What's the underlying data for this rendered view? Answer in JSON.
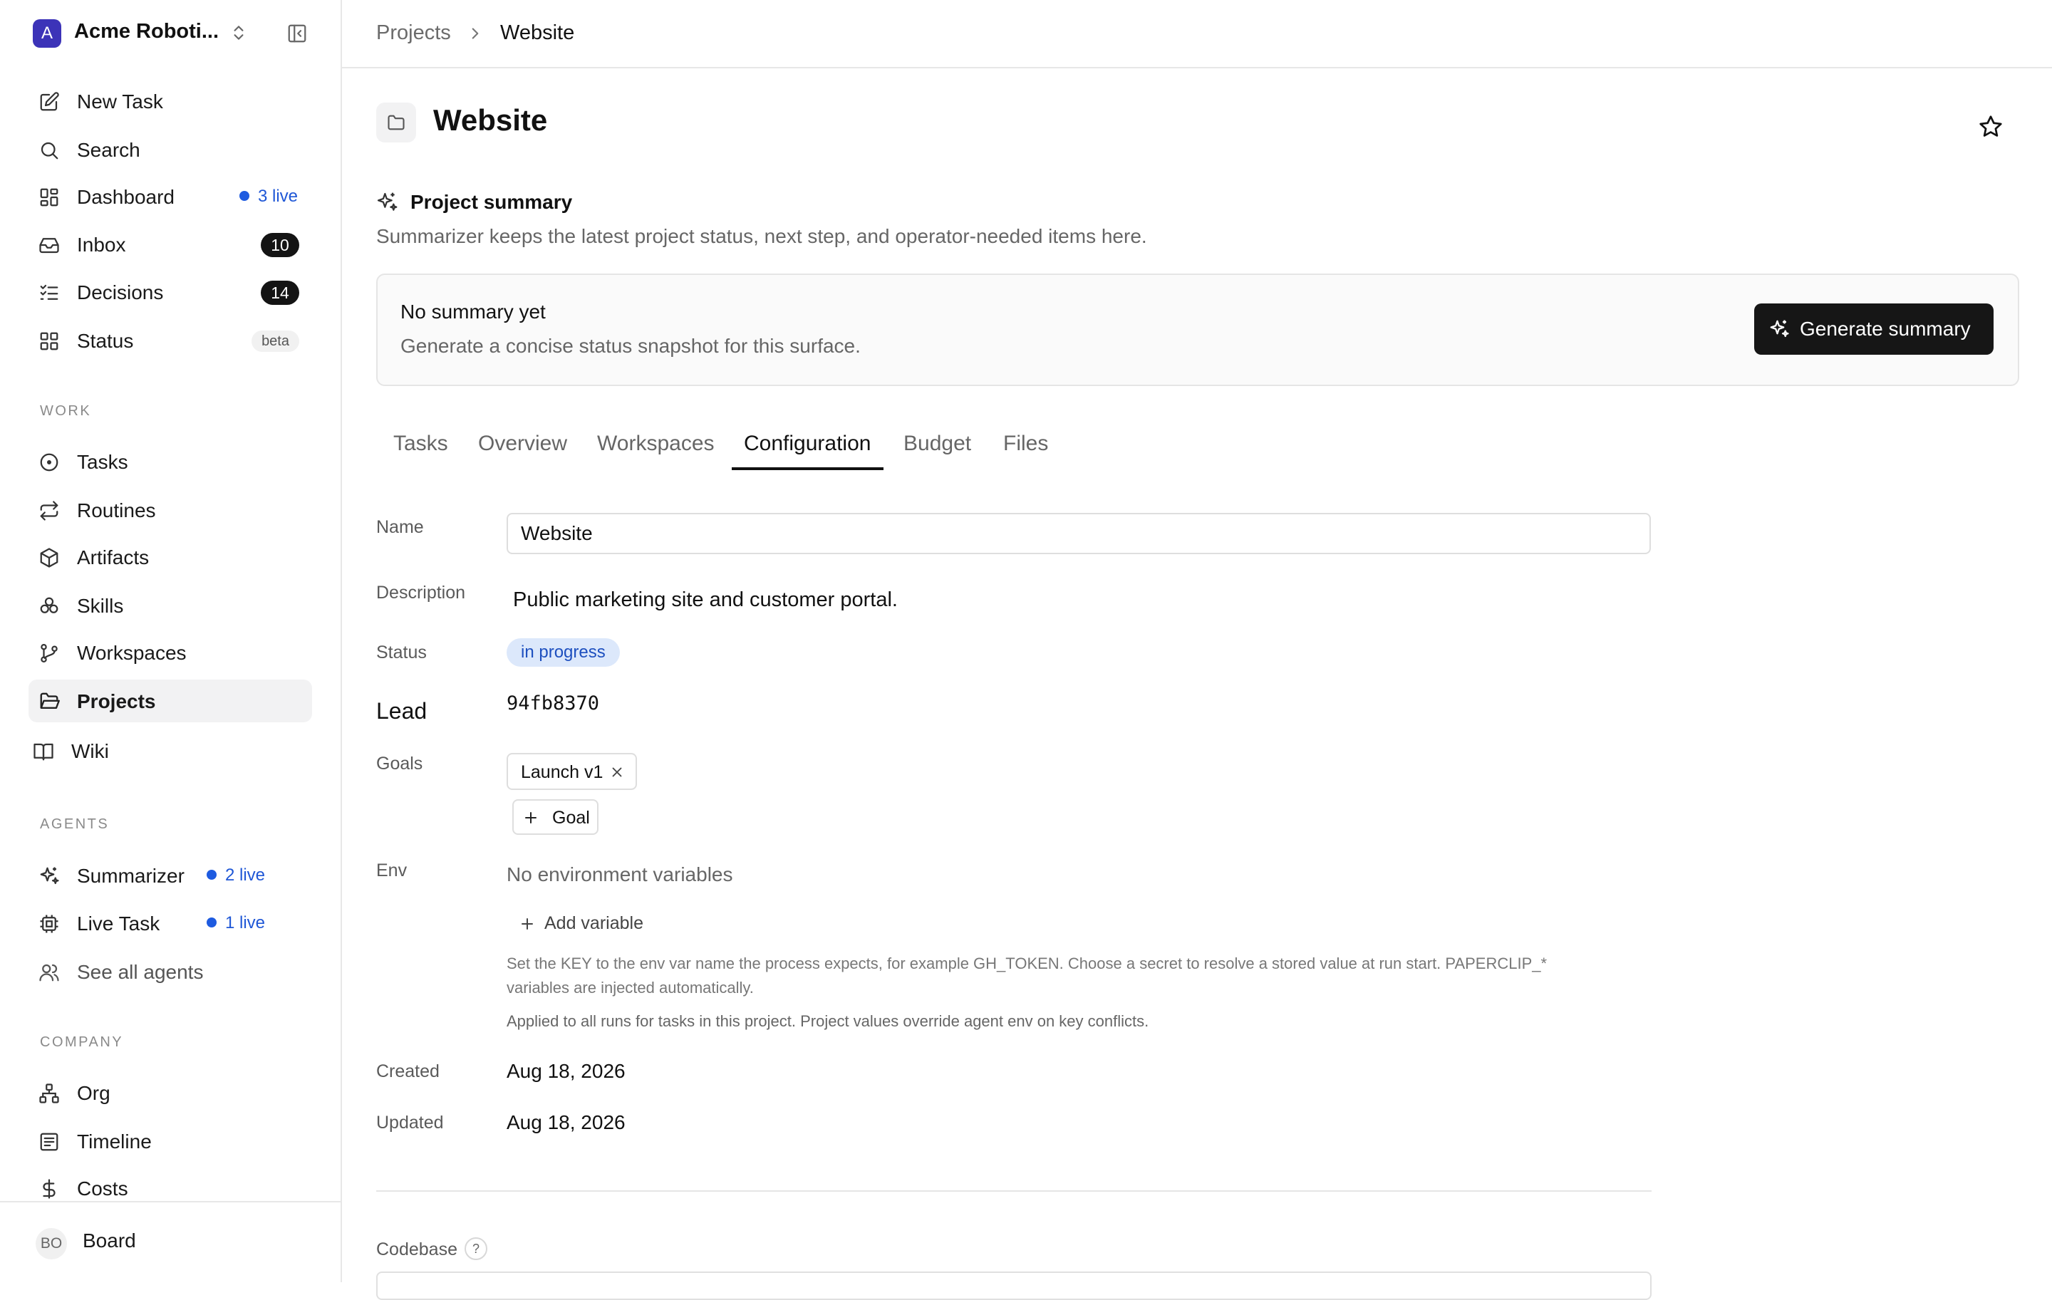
{
  "company": {
    "logo_letter": "A",
    "name": "Acme Roboti..."
  },
  "nav_main": [
    {
      "label": "New Task",
      "icon": "new-task-icon"
    },
    {
      "label": "Search",
      "icon": "search-icon"
    },
    {
      "label": "Dashboard",
      "icon": "dashboard-icon",
      "live": "3 live"
    },
    {
      "label": "Inbox",
      "icon": "inbox-icon",
      "count": "10"
    },
    {
      "label": "Decisions",
      "icon": "decisions-icon",
      "count": "14"
    },
    {
      "label": "Status",
      "icon": "status-icon",
      "badge": "beta"
    }
  ],
  "sections": {
    "work": "WORK",
    "agents": "AGENTS",
    "company": "COMPANY"
  },
  "nav_work": [
    {
      "label": "Tasks",
      "icon": "tasks-icon"
    },
    {
      "label": "Routines",
      "icon": "routines-icon"
    },
    {
      "label": "Artifacts",
      "icon": "artifacts-icon"
    },
    {
      "label": "Skills",
      "icon": "skills-icon"
    },
    {
      "label": "Workspaces",
      "icon": "workspaces-icon"
    },
    {
      "label": "Projects",
      "icon": "projects-icon",
      "active": true
    },
    {
      "label": "Wiki",
      "icon": "wiki-icon"
    }
  ],
  "nav_agents": [
    {
      "label": "Summarizer",
      "icon": "summarizer-icon",
      "live": "2 live"
    },
    {
      "label": "Live Task",
      "icon": "live-task-icon",
      "live": "1 live"
    },
    {
      "label": "See all agents",
      "icon": "agents-icon"
    }
  ],
  "nav_company": [
    {
      "label": "Org",
      "icon": "org-icon"
    },
    {
      "label": "Timeline",
      "icon": "timeline-icon"
    },
    {
      "label": "Costs",
      "icon": "costs-icon"
    }
  ],
  "footer": {
    "avatar": "BO",
    "label": "Board"
  },
  "breadcrumb": {
    "parent": "Projects",
    "current": "Website"
  },
  "page": {
    "title": "Website"
  },
  "summary": {
    "heading": "Project summary",
    "description": "Summarizer keeps the latest project status, next step, and operator-needed items here.",
    "empty_title": "No summary yet",
    "empty_text": "Generate a concise status snapshot for this surface.",
    "button": "Generate summary"
  },
  "tabs": [
    "Tasks",
    "Overview",
    "Workspaces",
    "Configuration",
    "Budget",
    "Files"
  ],
  "active_tab": "Configuration",
  "config": {
    "labels": {
      "name": "Name",
      "description": "Description",
      "status": "Status",
      "lead": "Lead",
      "goals": "Goals",
      "env": "Env",
      "created": "Created",
      "updated": "Updated",
      "codebase": "Codebase"
    },
    "name_value": "Website",
    "description_value": "Public marketing site and customer portal.",
    "status_value": "in progress",
    "lead_value": "94fb8370",
    "goals": [
      "Launch v1"
    ],
    "add_goal": "Goal",
    "env_empty": "No environment variables",
    "add_variable": "Add variable",
    "env_help_1": "Set the KEY to the env var name the process expects, for example GH_TOKEN. Choose a secret to resolve a stored value at run start. PAPERCLIP_*",
    "env_help_2": "variables are injected automatically.",
    "env_help_3": "Applied to all runs for tasks in this project. Project values override agent env on key conflicts.",
    "created_value": "Aug 18, 2026",
    "updated_value": "Aug 18, 2026",
    "codebase_help": "?"
  },
  "colors": {
    "accent_live": "#1e5be0",
    "status_bg": "#dce8fb",
    "status_text": "#1d4fbf",
    "primary_button": "#161616"
  }
}
